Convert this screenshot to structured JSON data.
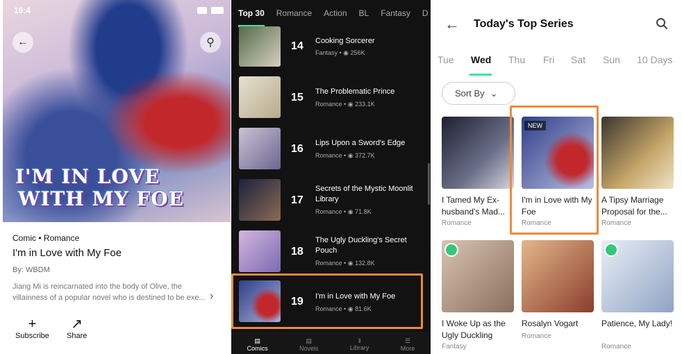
{
  "panel1": {
    "status_time": "16:4",
    "cover_title_line1": "I'M IN LOVE",
    "cover_title_line2": "WITH MY FOE",
    "meta_type": "Comic",
    "meta_genre": "Romance",
    "title": "I'm in Love with My Foe",
    "author": "By: WBDM",
    "description": "Jiang Mi is reincarnated into the body of Olive, the villainness of a popular novel who is destined to be exe...",
    "actions": [
      {
        "label": "Subscribe",
        "icon": "plus-icon"
      },
      {
        "label": "Share",
        "icon": "share-icon"
      }
    ]
  },
  "panel2": {
    "tabs": [
      "Top 30",
      "Romance",
      "Action",
      "BL",
      "Fantasy",
      "D"
    ],
    "items": [
      {
        "rank": "14",
        "title": "Cooking Sorcerer",
        "genre": "Fantasy",
        "views": "256K",
        "color": "#6f7e5a"
      },
      {
        "rank": "15",
        "title": "The Problematic Prince",
        "genre": "Romance",
        "views": "233.1K",
        "color": "#c9c0a8"
      },
      {
        "rank": "16",
        "title": "Lips Upon a Sword's Edge",
        "genre": "Romance",
        "views": "372.7K",
        "color": "#9d95b3"
      },
      {
        "rank": "17",
        "title": "Secrets of the Mystic Moonlit Library",
        "genre": "Romance",
        "views": "71.8K",
        "color": "#3a3f6b"
      },
      {
        "rank": "18",
        "title": "The Ugly Duckling's Secret Pouch",
        "genre": "Romance",
        "views": "132.8K",
        "color": "#b58fc4"
      },
      {
        "rank": "19",
        "title": "I'm in Love with My Foe",
        "genre": "Romance",
        "views": "81.6K",
        "color": "#2f3f8a"
      }
    ],
    "nav": [
      "Comics",
      "Novels",
      "Library",
      "More"
    ]
  },
  "panel3": {
    "title": "Today's Top Series",
    "days": [
      "Tue",
      "Wed",
      "Thu",
      "Fri",
      "Sat",
      "Sun",
      "10 Days"
    ],
    "sort_label": "Sort By",
    "cards": [
      {
        "title": "I Tamed My Ex-husband's Mad...",
        "genre": "Romance",
        "color": "#2b2d3a"
      },
      {
        "title": "I'm in Love with My Foe",
        "genre": "Romance",
        "color": "#4b5aa0",
        "badge": "NEW"
      },
      {
        "title": "A Tipsy Marriage Proposal for the...",
        "genre": "Romance",
        "color": "#7c6b4a"
      },
      {
        "title": "I Woke Up as the Ugly Duckling",
        "genre": "Fantasy",
        "color": "#b79a88"
      },
      {
        "title": "Rosalyn Vogart",
        "genre": "Romance",
        "color": "#9a5a3c"
      },
      {
        "title": "Patience, My Lady!",
        "genre": "Romance",
        "color": "#b9c6d9"
      }
    ],
    "accent": "#3ee39b",
    "highlight": "#ef8a3a"
  }
}
